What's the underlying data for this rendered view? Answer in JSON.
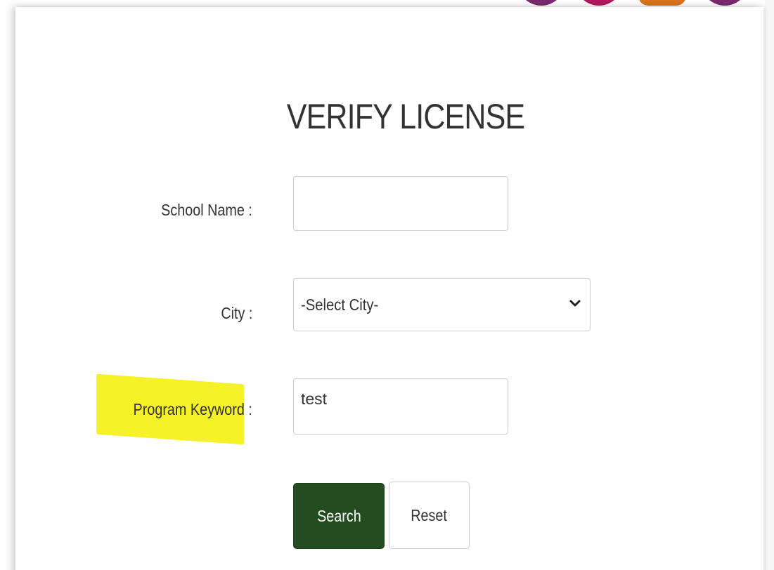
{
  "form": {
    "title": "VERIFY LICENSE",
    "school_name": {
      "label": "School Name :",
      "value": ""
    },
    "city": {
      "label": "City :",
      "selected": "-Select City-",
      "chevron_icon": "chevron-down-icon"
    },
    "program_keyword": {
      "label": "Program Keyword :",
      "value": "test",
      "highlight_color": "#f5f227"
    },
    "buttons": {
      "search": "Search",
      "reset": "Reset"
    }
  },
  "colors": {
    "search_button": "#234d20",
    "deco_shapes": [
      "#7a2a6e",
      "#b5175e",
      "#d9741c",
      "#7a2a6e"
    ]
  }
}
